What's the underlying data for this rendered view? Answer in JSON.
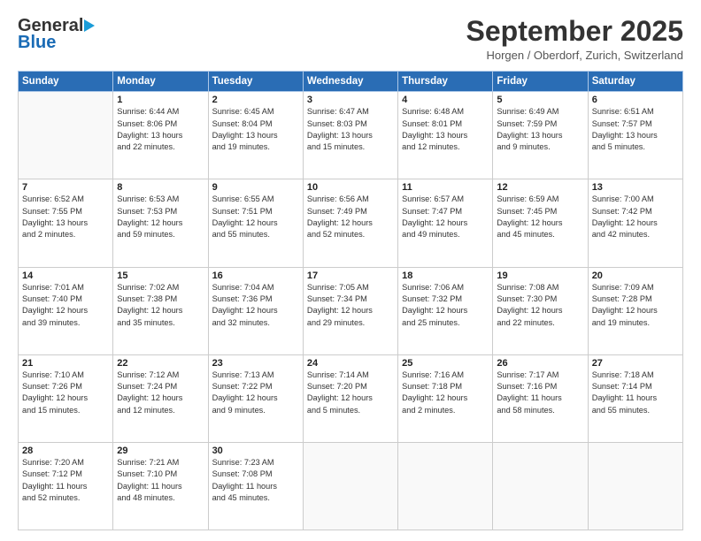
{
  "header": {
    "logo_general": "General",
    "logo_blue": "Blue",
    "title": "September 2025",
    "location": "Horgen / Oberdorf, Zurich, Switzerland"
  },
  "weekdays": [
    "Sunday",
    "Monday",
    "Tuesday",
    "Wednesday",
    "Thursday",
    "Friday",
    "Saturday"
  ],
  "weeks": [
    [
      {
        "day": "",
        "info": ""
      },
      {
        "day": "1",
        "info": "Sunrise: 6:44 AM\nSunset: 8:06 PM\nDaylight: 13 hours\nand 22 minutes."
      },
      {
        "day": "2",
        "info": "Sunrise: 6:45 AM\nSunset: 8:04 PM\nDaylight: 13 hours\nand 19 minutes."
      },
      {
        "day": "3",
        "info": "Sunrise: 6:47 AM\nSunset: 8:03 PM\nDaylight: 13 hours\nand 15 minutes."
      },
      {
        "day": "4",
        "info": "Sunrise: 6:48 AM\nSunset: 8:01 PM\nDaylight: 13 hours\nand 12 minutes."
      },
      {
        "day": "5",
        "info": "Sunrise: 6:49 AM\nSunset: 7:59 PM\nDaylight: 13 hours\nand 9 minutes."
      },
      {
        "day": "6",
        "info": "Sunrise: 6:51 AM\nSunset: 7:57 PM\nDaylight: 13 hours\nand 5 minutes."
      }
    ],
    [
      {
        "day": "7",
        "info": "Sunrise: 6:52 AM\nSunset: 7:55 PM\nDaylight: 13 hours\nand 2 minutes."
      },
      {
        "day": "8",
        "info": "Sunrise: 6:53 AM\nSunset: 7:53 PM\nDaylight: 12 hours\nand 59 minutes."
      },
      {
        "day": "9",
        "info": "Sunrise: 6:55 AM\nSunset: 7:51 PM\nDaylight: 12 hours\nand 55 minutes."
      },
      {
        "day": "10",
        "info": "Sunrise: 6:56 AM\nSunset: 7:49 PM\nDaylight: 12 hours\nand 52 minutes."
      },
      {
        "day": "11",
        "info": "Sunrise: 6:57 AM\nSunset: 7:47 PM\nDaylight: 12 hours\nand 49 minutes."
      },
      {
        "day": "12",
        "info": "Sunrise: 6:59 AM\nSunset: 7:45 PM\nDaylight: 12 hours\nand 45 minutes."
      },
      {
        "day": "13",
        "info": "Sunrise: 7:00 AM\nSunset: 7:42 PM\nDaylight: 12 hours\nand 42 minutes."
      }
    ],
    [
      {
        "day": "14",
        "info": "Sunrise: 7:01 AM\nSunset: 7:40 PM\nDaylight: 12 hours\nand 39 minutes."
      },
      {
        "day": "15",
        "info": "Sunrise: 7:02 AM\nSunset: 7:38 PM\nDaylight: 12 hours\nand 35 minutes."
      },
      {
        "day": "16",
        "info": "Sunrise: 7:04 AM\nSunset: 7:36 PM\nDaylight: 12 hours\nand 32 minutes."
      },
      {
        "day": "17",
        "info": "Sunrise: 7:05 AM\nSunset: 7:34 PM\nDaylight: 12 hours\nand 29 minutes."
      },
      {
        "day": "18",
        "info": "Sunrise: 7:06 AM\nSunset: 7:32 PM\nDaylight: 12 hours\nand 25 minutes."
      },
      {
        "day": "19",
        "info": "Sunrise: 7:08 AM\nSunset: 7:30 PM\nDaylight: 12 hours\nand 22 minutes."
      },
      {
        "day": "20",
        "info": "Sunrise: 7:09 AM\nSunset: 7:28 PM\nDaylight: 12 hours\nand 19 minutes."
      }
    ],
    [
      {
        "day": "21",
        "info": "Sunrise: 7:10 AM\nSunset: 7:26 PM\nDaylight: 12 hours\nand 15 minutes."
      },
      {
        "day": "22",
        "info": "Sunrise: 7:12 AM\nSunset: 7:24 PM\nDaylight: 12 hours\nand 12 minutes."
      },
      {
        "day": "23",
        "info": "Sunrise: 7:13 AM\nSunset: 7:22 PM\nDaylight: 12 hours\nand 9 minutes."
      },
      {
        "day": "24",
        "info": "Sunrise: 7:14 AM\nSunset: 7:20 PM\nDaylight: 12 hours\nand 5 minutes."
      },
      {
        "day": "25",
        "info": "Sunrise: 7:16 AM\nSunset: 7:18 PM\nDaylight: 12 hours\nand 2 minutes."
      },
      {
        "day": "26",
        "info": "Sunrise: 7:17 AM\nSunset: 7:16 PM\nDaylight: 11 hours\nand 58 minutes."
      },
      {
        "day": "27",
        "info": "Sunrise: 7:18 AM\nSunset: 7:14 PM\nDaylight: 11 hours\nand 55 minutes."
      }
    ],
    [
      {
        "day": "28",
        "info": "Sunrise: 7:20 AM\nSunset: 7:12 PM\nDaylight: 11 hours\nand 52 minutes."
      },
      {
        "day": "29",
        "info": "Sunrise: 7:21 AM\nSunset: 7:10 PM\nDaylight: 11 hours\nand 48 minutes."
      },
      {
        "day": "30",
        "info": "Sunrise: 7:23 AM\nSunset: 7:08 PM\nDaylight: 11 hours\nand 45 minutes."
      },
      {
        "day": "",
        "info": ""
      },
      {
        "day": "",
        "info": ""
      },
      {
        "day": "",
        "info": ""
      },
      {
        "day": "",
        "info": ""
      }
    ]
  ]
}
